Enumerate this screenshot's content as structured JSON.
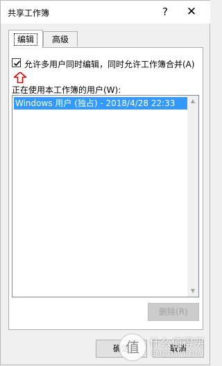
{
  "window": {
    "title": "共享工作簿",
    "help_label": "?",
    "close_label": "✕"
  },
  "tabs": [
    {
      "label": "编辑",
      "active": true
    },
    {
      "label": "高级",
      "active": false
    }
  ],
  "editing": {
    "allow_changes_label": "允许多用户同时编辑，同时允许工作簿合并(A)",
    "allow_changes_checked": true,
    "annotation_icon": "red-up-arrow-icon",
    "users_label": "正在使用本工作簿的用户(W):",
    "users": [
      "Windows 用户 (独占) - 2018/4/28 22:33"
    ],
    "remove_label": "删除(R)"
  },
  "footer": {
    "ok_label": "确定",
    "cancel_label": "取消"
  },
  "watermark": {
    "line1": "什么值得买",
    "line2": "SMZDM.COM"
  },
  "colors": {
    "selection": "#3399ff",
    "arrow": "#e00000"
  }
}
